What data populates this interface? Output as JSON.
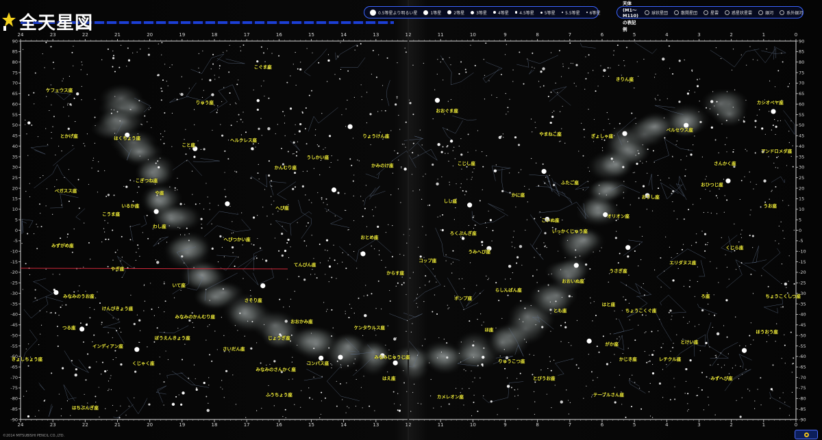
{
  "title": "全天星図",
  "footer": "©2014 MITSUBISHI PENCIL CO.,LTD.",
  "legend": {
    "magnitudes": [
      "0.5等星より明るい星",
      "1等星",
      "2等星",
      "3等星",
      "4等星",
      "4.5等星",
      "5等星",
      "5.5等星",
      "6等星"
    ],
    "misc_title": "メシエ天体 (M1～M110) の表記例",
    "misc_items": [
      "球状星団",
      "散開星団",
      "星雲",
      "惑星状星雲",
      "銀河",
      "系外銀河"
    ]
  },
  "axes": {
    "ra_hours": [
      "24",
      "23",
      "22",
      "21",
      "20",
      "19",
      "18",
      "17",
      "16",
      "15",
      "14",
      "13",
      "12",
      "11",
      "10",
      "9",
      "8",
      "7",
      "6",
      "5",
      "4",
      "3",
      "2",
      "1",
      "0"
    ],
    "dec_degrees": [
      90,
      85,
      80,
      75,
      70,
      65,
      60,
      55,
      50,
      45,
      40,
      35,
      30,
      25,
      20,
      15,
      10,
      5,
      0,
      -5,
      -10,
      -15,
      -20,
      -25,
      -30,
      -35,
      -40,
      -45,
      -50,
      -55,
      -60,
      -65,
      -70,
      -75,
      -80,
      -85,
      -90
    ]
  },
  "constellations": [
    {
      "name": "こぐま座",
      "ra": 16.5,
      "dec": 78
    },
    {
      "name": "きりん座",
      "ra": 5.3,
      "dec": 72
    },
    {
      "name": "ケフェウス座",
      "ra": 22.8,
      "dec": 67
    },
    {
      "name": "りゅう座",
      "ra": 18.3,
      "dec": 61
    },
    {
      "name": "カシオペヤ座",
      "ra": 0.8,
      "dec": 61
    },
    {
      "name": "はくちょう座",
      "ra": 20.7,
      "dec": 44
    },
    {
      "name": "とかげ座",
      "ra": 22.5,
      "dec": 45
    },
    {
      "name": "こと座",
      "ra": 18.8,
      "dec": 41
    },
    {
      "name": "ヘルクレス座",
      "ra": 17.1,
      "dec": 43
    },
    {
      "name": "うしかい座",
      "ra": 14.8,
      "dec": 35
    },
    {
      "name": "りょうけん座",
      "ra": 13.0,
      "dec": 45
    },
    {
      "name": "かみのけ座",
      "ra": 12.8,
      "dec": 31
    },
    {
      "name": "おおぐま座",
      "ra": 10.8,
      "dec": 57
    },
    {
      "name": "やまねこ座",
      "ra": 7.6,
      "dec": 46
    },
    {
      "name": "ペルセウス座",
      "ra": 3.6,
      "dec": 48
    },
    {
      "name": "ぎょしゃ座",
      "ra": 6.0,
      "dec": 45
    },
    {
      "name": "アンドロメダ座",
      "ra": 0.6,
      "dec": 38
    },
    {
      "name": "さんかく座",
      "ra": 2.2,
      "dec": 32
    },
    {
      "name": "おひつじ座",
      "ra": 2.6,
      "dec": 22
    },
    {
      "name": "ふたご座",
      "ra": 7.0,
      "dec": 23
    },
    {
      "name": "こじし座",
      "ra": 10.2,
      "dec": 32
    },
    {
      "name": "しし座",
      "ra": 10.7,
      "dec": 14
    },
    {
      "name": "かに座",
      "ra": 8.6,
      "dec": 17
    },
    {
      "name": "こいぬ座",
      "ra": 7.6,
      "dec": 5
    },
    {
      "name": "オリオン座",
      "ra": 5.5,
      "dec": 7
    },
    {
      "name": "おうし座",
      "ra": 4.5,
      "dec": 16
    },
    {
      "name": "うお座",
      "ra": 0.8,
      "dec": 12
    },
    {
      "name": "ペガスス座",
      "ra": 22.6,
      "dec": 19
    },
    {
      "name": "こうま座",
      "ra": 21.2,
      "dec": 8
    },
    {
      "name": "いるか座",
      "ra": 20.6,
      "dec": 12
    },
    {
      "name": "こぎつね座",
      "ra": 20.1,
      "dec": 24
    },
    {
      "name": "や座",
      "ra": 19.7,
      "dec": 18
    },
    {
      "name": "わし座",
      "ra": 19.7,
      "dec": 2
    },
    {
      "name": "へび座",
      "ra": 15.9,
      "dec": 11
    },
    {
      "name": "へびつかい座",
      "ra": 17.3,
      "dec": -4
    },
    {
      "name": "かんむり座",
      "ra": 15.8,
      "dec": 30
    },
    {
      "name": "おとめ座",
      "ra": 13.2,
      "dec": -3
    },
    {
      "name": "コップ座",
      "ra": 11.4,
      "dec": -14
    },
    {
      "name": "からす座",
      "ra": 12.4,
      "dec": -20
    },
    {
      "name": "うみへび座",
      "ra": 9.8,
      "dec": -10
    },
    {
      "name": "ろくぶんぎ座",
      "ra": 10.3,
      "dec": -1
    },
    {
      "name": "いっかくじゅう座",
      "ra": 7.0,
      "dec": 0
    },
    {
      "name": "エリダヌス座",
      "ra": 3.5,
      "dec": -15
    },
    {
      "name": "くじら座",
      "ra": 1.9,
      "dec": -8
    },
    {
      "name": "みずがめ座",
      "ra": 22.7,
      "dec": -7
    },
    {
      "name": "やぎ座",
      "ra": 21.0,
      "dec": -18
    },
    {
      "name": "いて座",
      "ra": 19.1,
      "dec": -26
    },
    {
      "name": "さそり座",
      "ra": 16.8,
      "dec": -33
    },
    {
      "name": "てんびん座",
      "ra": 15.2,
      "dec": -16
    },
    {
      "name": "おおかみ座",
      "ra": 15.3,
      "dec": -43
    },
    {
      "name": "ケンタウルス座",
      "ra": 13.2,
      "dec": -46
    },
    {
      "name": "ポンプ座",
      "ra": 10.3,
      "dec": -32
    },
    {
      "name": "らしんばん座",
      "ra": 8.9,
      "dec": -28
    },
    {
      "name": "とも座",
      "ra": 7.3,
      "dec": -38
    },
    {
      "name": "おおいぬ座",
      "ra": 6.9,
      "dec": -24
    },
    {
      "name": "うさぎ座",
      "ra": 5.5,
      "dec": -19
    },
    {
      "name": "はと座",
      "ra": 5.8,
      "dec": -35
    },
    {
      "name": "ちょうこくしつ座",
      "ra": 0.4,
      "dec": -31
    },
    {
      "name": "ほうおう座",
      "ra": 0.9,
      "dec": -48
    },
    {
      "name": "ろ座",
      "ra": 2.8,
      "dec": -31
    },
    {
      "name": "ちょうこくぐ座",
      "ra": 4.8,
      "dec": -38
    },
    {
      "name": "とけい座",
      "ra": 3.3,
      "dec": -53
    },
    {
      "name": "みなみのうお座",
      "ra": 22.2,
      "dec": -31
    },
    {
      "name": "けんびきょう座",
      "ra": 21.0,
      "dec": -37
    },
    {
      "name": "つる座",
      "ra": 22.5,
      "dec": -46
    },
    {
      "name": "インディアン座",
      "ra": 21.3,
      "dec": -55
    },
    {
      "name": "ぼうえんきょう座",
      "ra": 19.3,
      "dec": -51
    },
    {
      "name": "さいだん座",
      "ra": 17.4,
      "dec": -56
    },
    {
      "name": "みなみのかんむり座",
      "ra": 18.6,
      "dec": -41
    },
    {
      "name": "じょうぎ座",
      "ra": 16.0,
      "dec": -51
    },
    {
      "name": "コンパス座",
      "ra": 14.8,
      "dec": -63
    },
    {
      "name": "みなみじゅうじ座",
      "ra": 12.5,
      "dec": -60
    },
    {
      "name": "はえ座",
      "ra": 12.6,
      "dec": -70
    },
    {
      "name": "カメレオン座",
      "ra": 10.7,
      "dec": -79
    },
    {
      "name": "りゅうこつ座",
      "ra": 8.8,
      "dec": -62
    },
    {
      "name": "ほ座",
      "ra": 9.5,
      "dec": -47
    },
    {
      "name": "がか座",
      "ra": 5.7,
      "dec": -54
    },
    {
      "name": "かじき座",
      "ra": 5.2,
      "dec": -61
    },
    {
      "name": "レチクル座",
      "ra": 3.9,
      "dec": -61
    },
    {
      "name": "みずへび座",
      "ra": 2.3,
      "dec": -70
    },
    {
      "name": "テーブルさん座",
      "ra": 5.8,
      "dec": -78
    },
    {
      "name": "とびうお座",
      "ra": 7.8,
      "dec": -70
    },
    {
      "name": "きょしちょう座",
      "ra": 23.8,
      "dec": -61
    },
    {
      "name": "くじゃく座",
      "ra": 20.2,
      "dec": -63
    },
    {
      "name": "みなみのさんかく座",
      "ra": 16.1,
      "dec": -66
    },
    {
      "name": "ふうちょう座",
      "ra": 16.0,
      "dec": -78
    },
    {
      "name": "はちぶんぎ座",
      "ra": 22.0,
      "dec": -84
    }
  ],
  "bright_stars": [
    {
      "ra": 18.6,
      "dec": 38.8
    },
    {
      "ra": 20.7,
      "dec": 45.3
    },
    {
      "ra": 19.8,
      "dec": 8.9
    },
    {
      "ra": 14.3,
      "dec": 19.2
    },
    {
      "ra": 13.4,
      "dec": -11.2
    },
    {
      "ra": 16.5,
      "dec": -26.4
    },
    {
      "ra": 5.9,
      "dec": 7.4
    },
    {
      "ra": 5.2,
      "dec": -8.2
    },
    {
      "ra": 6.8,
      "dec": -16.7
    },
    {
      "ra": 7.7,
      "dec": 5.2
    },
    {
      "ra": 7.8,
      "dec": 28.0
    },
    {
      "ra": 5.3,
      "dec": 46.0
    },
    {
      "ra": 4.6,
      "dec": 16.5
    },
    {
      "ra": 10.1,
      "dec": 12.0
    },
    {
      "ra": 6.4,
      "dec": -52.7
    },
    {
      "ra": 14.7,
      "dec": -60.8
    },
    {
      "ra": 14.1,
      "dec": -60.4
    },
    {
      "ra": 12.4,
      "dec": -63.1
    },
    {
      "ra": 12.8,
      "dec": -59.7
    },
    {
      "ra": 1.6,
      "dec": -57.2
    },
    {
      "ra": 22.9,
      "dec": -29.6
    },
    {
      "ra": 20.4,
      "dec": -56.7
    },
    {
      "ra": 3.4,
      "dec": 49.9
    },
    {
      "ra": 2.1,
      "dec": 23.5
    },
    {
      "ra": 0.7,
      "dec": 56.5
    },
    {
      "ra": 11.1,
      "dec": 61.8
    },
    {
      "ra": 13.8,
      "dec": 49.3
    },
    {
      "ra": 17.6,
      "dec": 12.6
    },
    {
      "ra": 22.1,
      "dec": -47.0
    },
    {
      "ra": 9.5,
      "dec": -8.7
    }
  ]
}
